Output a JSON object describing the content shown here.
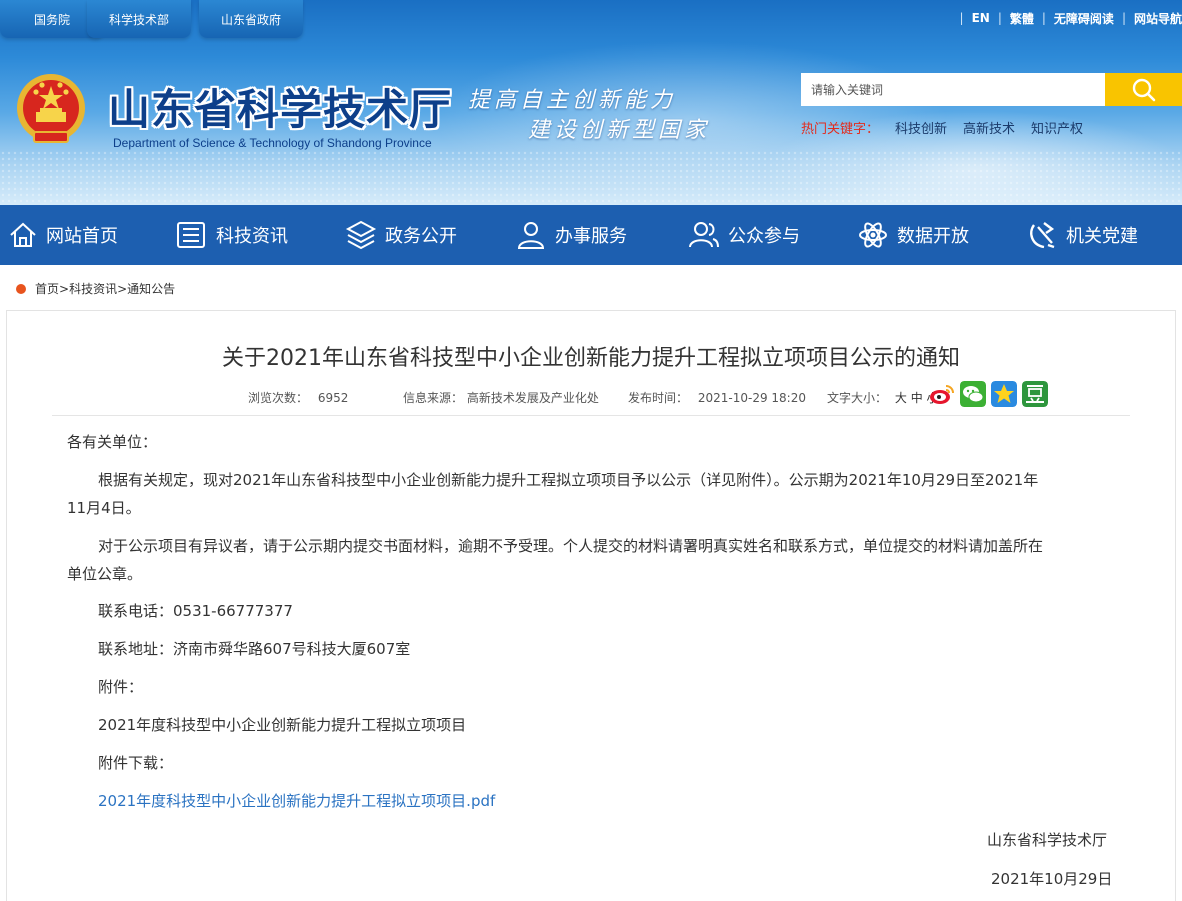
{
  "top_links": [
    "国务院",
    "科学技术部",
    "山东省政府"
  ],
  "right_links": [
    "EN",
    "繁體",
    "无障碍阅读",
    "网站导航"
  ],
  "site": {
    "title": "山东省科学技术厅",
    "en": "Department of Science & Technology of Shandong Province",
    "slogan1": "提高自主创新能力",
    "slogan2": "建设创新型国家"
  },
  "search": {
    "placeholder": "请输入关键词"
  },
  "hot": {
    "label": "热门关键字：",
    "keywords": [
      "科技创新",
      "高新技术",
      "知识产权"
    ]
  },
  "nav": [
    "网站首页",
    "科技资讯",
    "政务公开",
    "办事服务",
    "公众参与",
    "数据开放",
    "机关党建"
  ],
  "breadcrumb": {
    "home": "首页",
    "section": "科技资讯",
    "page": "通知公告",
    "sep": ">"
  },
  "article": {
    "title": "关于2021年山东省科技型中小企业创新能力提升工程拟立项项目公示的通知",
    "views_label": "浏览次数：",
    "views": "6952",
    "source_label": "信息来源：",
    "source": "高新技术发展及产业化处",
    "date_label": "发布时间：",
    "date": "2021-10-29 18:20",
    "font_label": "文字大小：",
    "font_sizes": [
      "大",
      "中",
      "小"
    ],
    "salutation": "各有关单位：",
    "para1_a": "根据有关规定，现对2021年山东省科技型中小企业创新能力提升工程拟立项项目予以公示（详见附件）。公示期为2021年10月29日至2021年",
    "para1_b": "11月4日。",
    "para2_a": "对于公示项目有异议者，请于公示期内提交书面材料，逾期不予受理。个人提交的材料请署明真实姓名和联系方式，单位提交的材料请加盖所在",
    "para2_b": "单位公章。",
    "phone": "联系电话：0531-66777377",
    "address": "联系地址：济南市舜华路607号科技大厦607室",
    "attach_label": "附件：",
    "attach_name": "2021年度科技型中小企业创新能力提升工程拟立项项目",
    "download_label": "附件下载：",
    "download_link": "2021年度科技型中小企业创新能力提升工程拟立项项目.pdf",
    "sign_org": "山东省科学技术厅",
    "sign_date": "2021年10月29日"
  },
  "colors": {
    "nav_bg": "#1d5fb0",
    "search_btn": "#f9c400",
    "hot_label": "#e32b1c",
    "link": "#2b73c2",
    "crumb_dot": "#e8541e"
  }
}
